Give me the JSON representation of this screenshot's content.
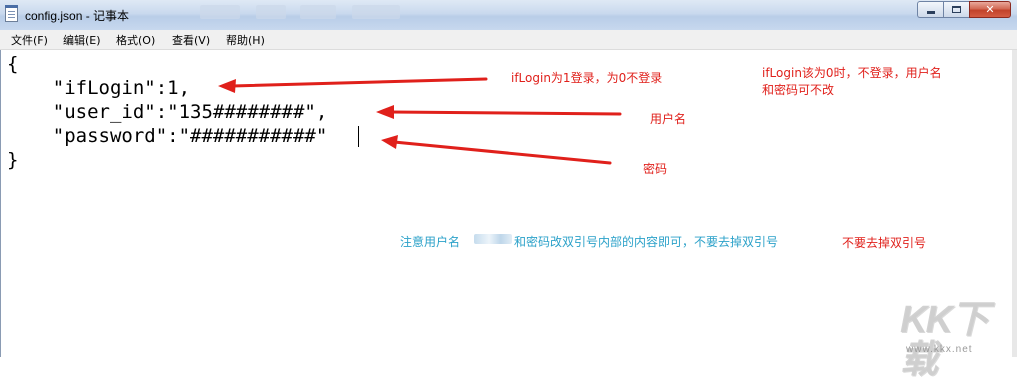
{
  "window": {
    "title": "config.json - 记事本",
    "minimize_icon": "minimize-icon",
    "maximize_icon": "maximize-icon",
    "close_glyph": "✕"
  },
  "menu": [
    "文件(F)",
    "编辑(E)",
    "格式(O)",
    "查看(V)",
    "帮助(H)"
  ],
  "editor": {
    "lines": [
      "{",
      "    \"ifLogin\":1,",
      "    \"user_id\":\"135########\",",
      "    \"password\":\"###########\"",
      "}"
    ]
  },
  "annotations": {
    "iflogin_note": "ifLogin为1登录，为0不登录",
    "side_note_line1": "ifLogin该为0时，不登录，用户名",
    "side_note_line2": "和密码可不改",
    "username_note": "用户名",
    "password_note": "密码",
    "notice_prefix": "注意用户名",
    "notice_suffix": "和密码改双引号内部的内容即可，不要去掉双引号",
    "notice_red": "不要去掉双引号"
  },
  "colors": {
    "annotation_red": "#e0201b",
    "annotation_blue": "#2ba1c9"
  },
  "watermark": {
    "logo": "KK下载",
    "url": "www.kkx.net"
  }
}
